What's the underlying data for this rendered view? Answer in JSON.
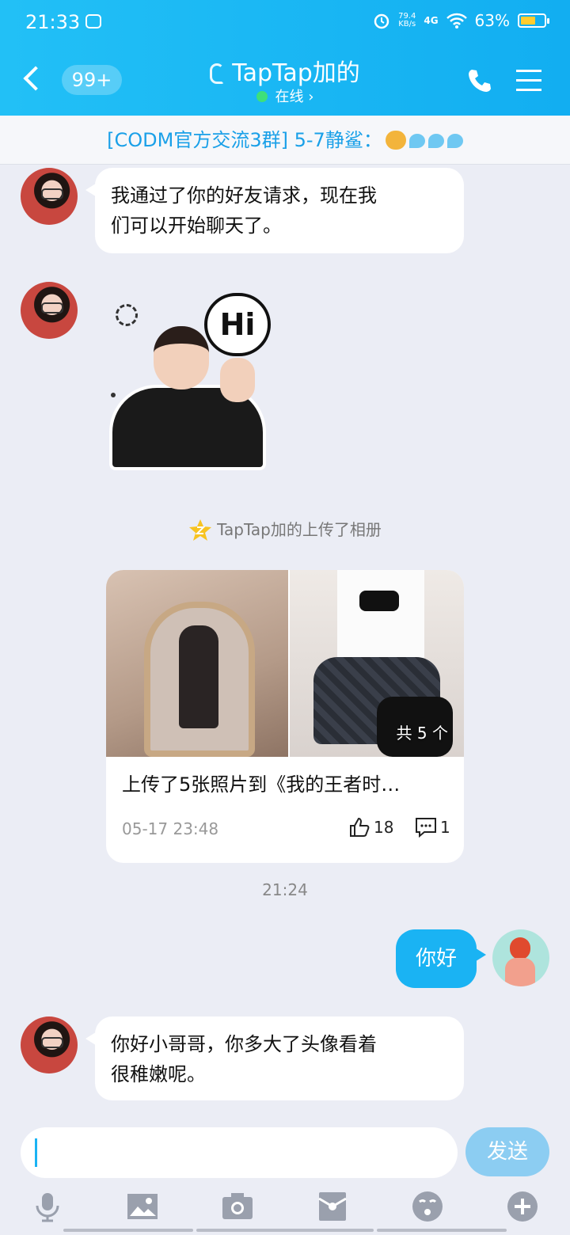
{
  "status_bar": {
    "time": "21:33",
    "speed_value": "79.4",
    "speed_unit": "KB/s",
    "network": "4G",
    "battery": "63%",
    "battery_level": 0.63
  },
  "header": {
    "unread_count": "99+",
    "contact_name": "TapTap加的",
    "status": "在线"
  },
  "banner": {
    "text": "[CODM官方交流3群] 5-7静鲨："
  },
  "messages": [
    {
      "sender": "them",
      "text_lines": [
        "我通过了你的好友请求，现在我",
        "们可以开始聊天了。"
      ]
    },
    {
      "sender": "them",
      "sticker": "Hi"
    },
    {
      "sender": "them",
      "text_lines": [
        "你好小哥哥，你多大了头像看着",
        "很稚嫩呢。"
      ]
    }
  ],
  "notice": {
    "text": "TapTap加的上传了相册"
  },
  "album_card": {
    "photo_count": "共 5 个",
    "title": "上传了5张照片到《我的王者时…",
    "date": "05-17 23:48",
    "likes": "18",
    "comments": "1"
  },
  "timestamp": "21:24",
  "my_message": "你好",
  "input": {
    "value": "",
    "send_label": "发送"
  },
  "toolbar": [
    "mic-icon",
    "image-icon",
    "camera-icon",
    "red-packet-icon",
    "emoji-icon",
    "plus-icon"
  ],
  "colors": {
    "header": "#1ab3f3",
    "my_bubble": "#1ab3f3",
    "send_button": "#8ccdf2",
    "background": "#ebedf5",
    "banner_text": "#1aa0e8"
  }
}
